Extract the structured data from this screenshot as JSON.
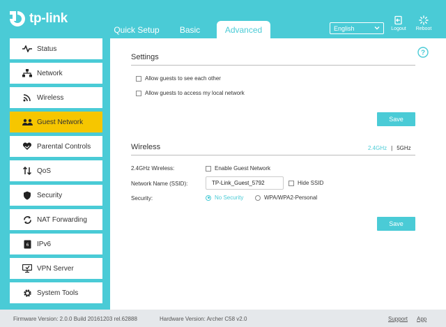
{
  "header": {
    "logo_text": "tp-link",
    "tabs": [
      {
        "label": "Quick Setup"
      },
      {
        "label": "Basic"
      },
      {
        "label": "Advanced"
      }
    ],
    "language": "English",
    "logout_label": "Logout",
    "reboot_label": "Reboot"
  },
  "sidebar": {
    "items": [
      {
        "label": "Status",
        "icon": "status-icon"
      },
      {
        "label": "Network",
        "icon": "network-icon"
      },
      {
        "label": "Wireless",
        "icon": "wireless-icon"
      },
      {
        "label": "Guest Network",
        "icon": "guest-network-icon"
      },
      {
        "label": "Parental Controls",
        "icon": "parental-controls-icon"
      },
      {
        "label": "QoS",
        "icon": "qos-icon"
      },
      {
        "label": "Security",
        "icon": "shield-icon"
      },
      {
        "label": "NAT Forwarding",
        "icon": "nat-forwarding-icon"
      },
      {
        "label": "IPv6",
        "icon": "ipv6-icon"
      },
      {
        "label": "VPN Server",
        "icon": "vpn-icon"
      },
      {
        "label": "System Tools",
        "icon": "gear-icon"
      }
    ],
    "active_index": 3
  },
  "settings": {
    "title": "Settings",
    "option1": "Allow guests to see each other",
    "option2": "Allow guests to access my local network",
    "save_label": "Save"
  },
  "wireless": {
    "title": "Wireless",
    "band_24": "2.4GHz",
    "band_sep": "|",
    "band_5": "5GHz",
    "wireless_label": "2.4GHz Wireless:",
    "enable_guest": "Enable Guest Network",
    "ssid_label": "Network Name (SSID):",
    "ssid_value": "TP-Link_Guest_5792",
    "hide_ssid": "Hide SSID",
    "security_label": "Security:",
    "no_security": "No Security",
    "wpa": "WPA/WPA2-Personal",
    "save_label": "Save"
  },
  "footer": {
    "firmware": "Firmware Version: 2.0.0 Build 20161203 rel.62888",
    "hardware": "Hardware Version: Archer C58 v2.0",
    "support": "Support",
    "app": "App"
  },
  "colors": {
    "accent": "#4acbd6",
    "active_item": "#f6c600",
    "footer_bg": "#e5e8eb"
  }
}
